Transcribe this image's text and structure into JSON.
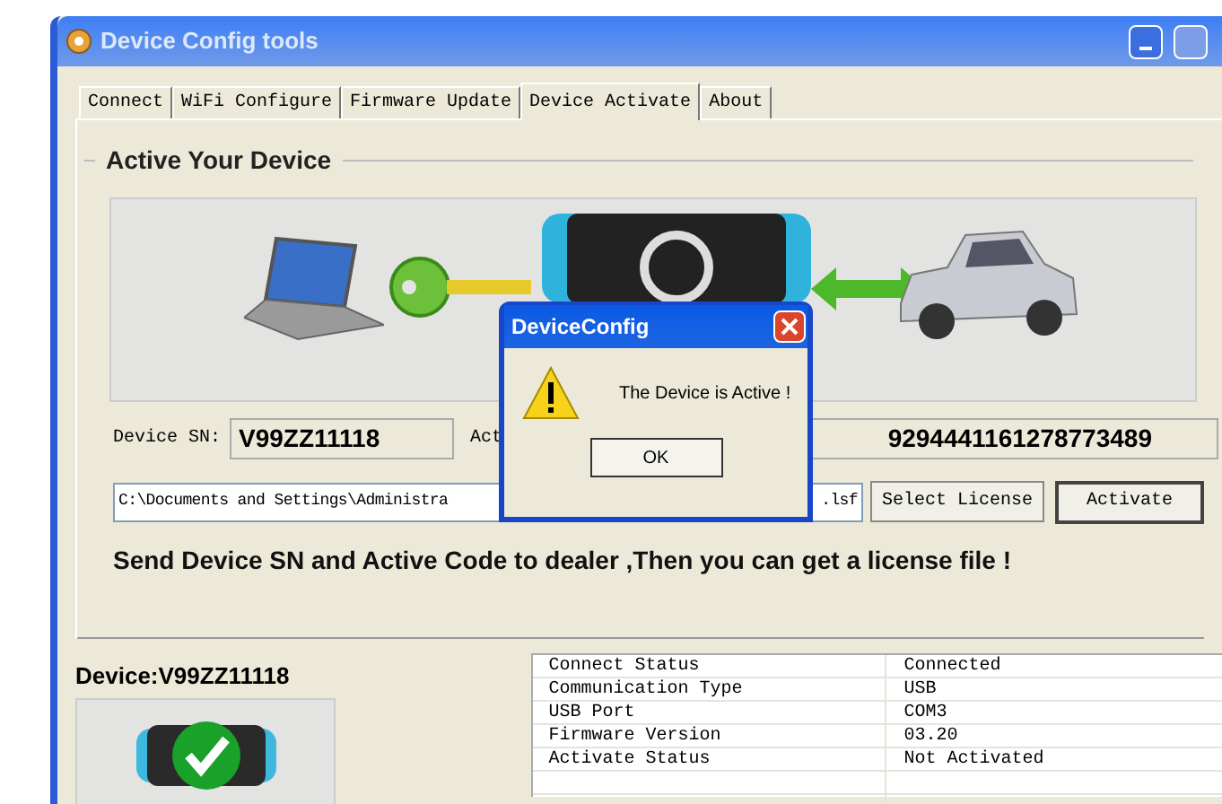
{
  "window": {
    "title": "Device Config tools"
  },
  "tabs": [
    {
      "label": "Connect",
      "selected": false
    },
    {
      "label": "WiFi Configure",
      "selected": false
    },
    {
      "label": "Firmware Update",
      "selected": false
    },
    {
      "label": "Device Activate",
      "selected": true
    },
    {
      "label": "About",
      "selected": false
    }
  ],
  "group_title": "Active Your Device",
  "device_sn": {
    "label": "Device SN:",
    "value": "V99ZZ11118"
  },
  "active_code": {
    "label": "Act",
    "value": "9294441161278773489"
  },
  "license_path": {
    "value_start": "C:\\Documents and Settings\\Administra",
    "value_end": ".lsf"
  },
  "buttons": [
    "Select License",
    "Activate"
  ],
  "instruction": "Send Device SN and Active Code to dealer ,Then you can get a license file !",
  "device_label": "Device:V99ZZ11118",
  "status_table": {
    "rows": [
      {
        "name": "Connect Status",
        "value": "Connected"
      },
      {
        "name": "Communication Type",
        "value": "USB"
      },
      {
        "name": "USB Port",
        "value": "COM3"
      },
      {
        "name": "Firmware Version",
        "value": "03.20"
      },
      {
        "name": "Activate Status",
        "value": "Not Activated"
      }
    ]
  },
  "dialog": {
    "title": "DeviceConfig",
    "message": "The Device is Active !",
    "button": "OK"
  }
}
